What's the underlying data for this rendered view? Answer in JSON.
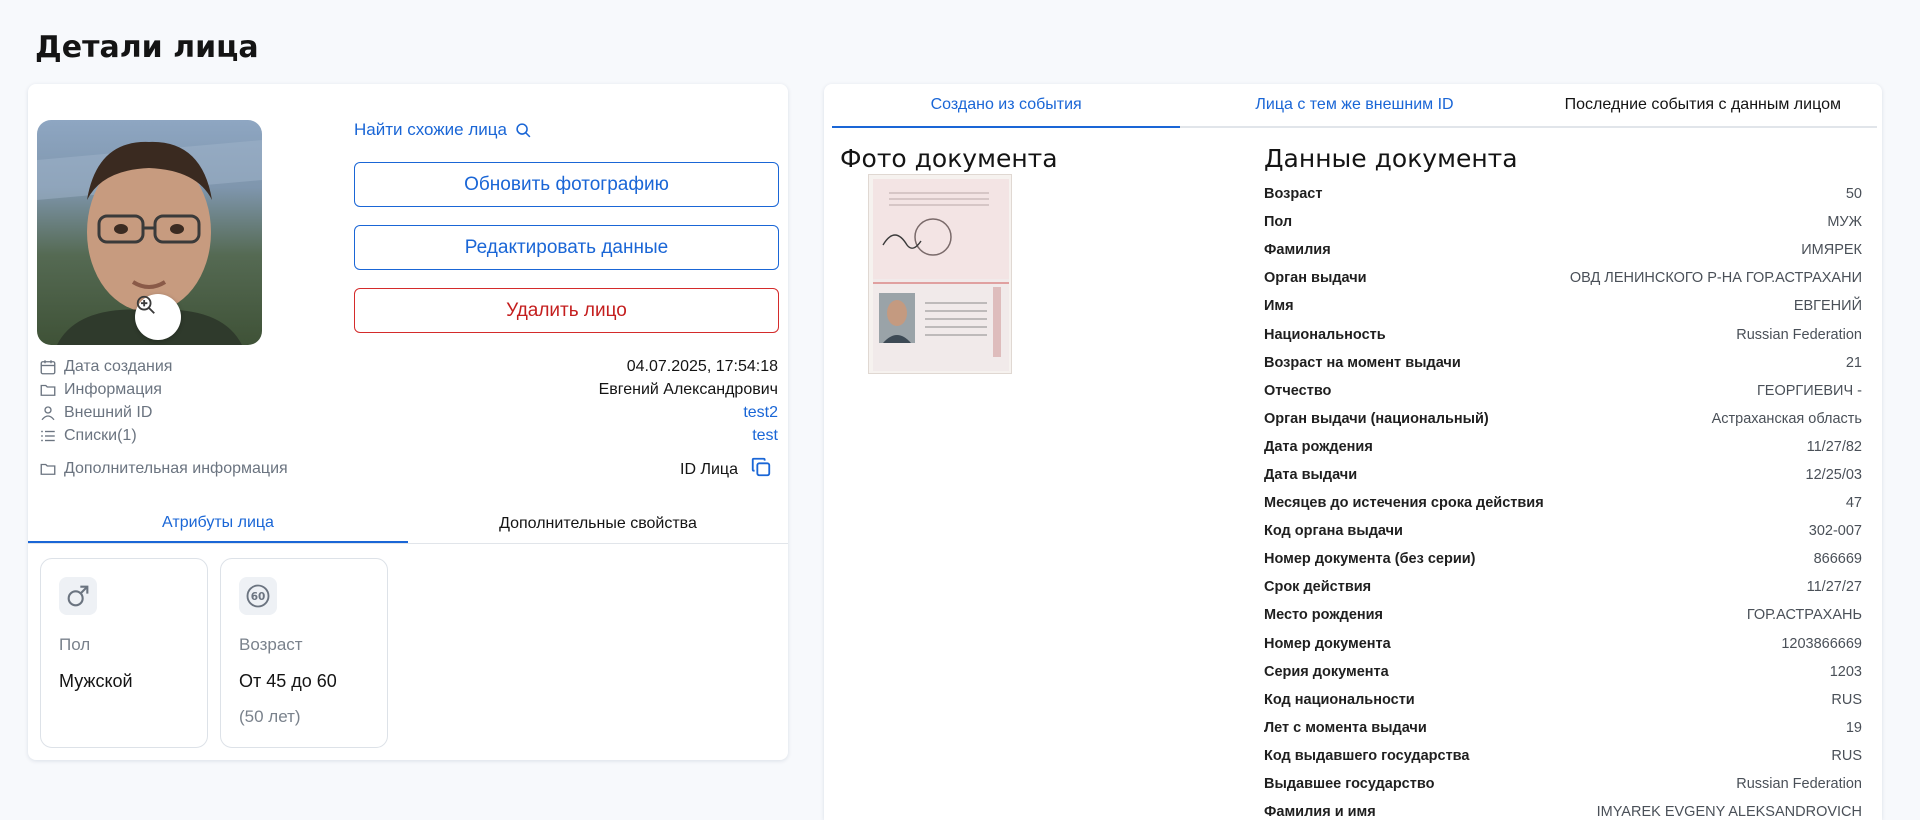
{
  "page": {
    "title": "Детали лица"
  },
  "face": {
    "find_similar": "Найти схожие лица",
    "buttons": {
      "update_photo": "Обновить фотографию",
      "edit_data": "Редактировать данные",
      "delete_face": "Удалить лицо"
    },
    "info": [
      {
        "label": "Дата создания",
        "value": "04.07.2025, 17:54:18",
        "icon": "calendar-icon",
        "link": false
      },
      {
        "label": "Информация",
        "value": "Евгений Александрович",
        "icon": "folder-icon",
        "link": false
      },
      {
        "label": "Внешний ID",
        "value": "test2",
        "icon": "user-icon",
        "link": true
      },
      {
        "label": "Списки(1)",
        "value": "test",
        "icon": "list-icon",
        "link": true
      }
    ],
    "additional_info_label": "Дополнительная информация",
    "id_face_label": "ID Лица",
    "tabs": [
      "Атрибуты лица",
      "Дополнительные свойства"
    ],
    "attributes": [
      {
        "label": "Пол",
        "value": "Мужской",
        "sub": "",
        "icon": "male-icon"
      },
      {
        "label": "Возраст",
        "value": "От 45 до 60",
        "sub": "(50 лет)",
        "icon": "age-60-icon"
      }
    ]
  },
  "colors": {
    "accent": "#1a66d6",
    "danger": "#c41e1e",
    "muted": "#6b7480"
  },
  "right": {
    "tabs": [
      "Создано из события",
      "Лица с тем же внешним ID",
      "Последние события с данным лицом"
    ],
    "doc_photo_title": "Фото документа",
    "doc_data_title": "Данные документа",
    "doc_fields": [
      {
        "key": "Возраст",
        "value": "50"
      },
      {
        "key": "Пол",
        "value": "МУЖ"
      },
      {
        "key": "Фамилия",
        "value": "ИМЯРЕК"
      },
      {
        "key": "Орган выдачи",
        "value": "ОВД ЛЕНИНСКОГО Р-НА ГОР.АСТРАХАНИ"
      },
      {
        "key": "Имя",
        "value": "ЕВГЕНИЙ"
      },
      {
        "key": "Национальность",
        "value": "Russian Federation"
      },
      {
        "key": "Возраст на момент выдачи",
        "value": "21"
      },
      {
        "key": "Отчество",
        "value": "ГЕОРГИЕВИЧ -"
      },
      {
        "key": "Орган выдачи (национальный)",
        "value": "Астраханская область"
      },
      {
        "key": "Дата рождения",
        "value": "11/27/82"
      },
      {
        "key": "Дата выдачи",
        "value": "12/25/03"
      },
      {
        "key": "Месяцев до истечения срока действия",
        "value": "47"
      },
      {
        "key": "Код органа выдачи",
        "value": "302-007"
      },
      {
        "key": "Номер документа (без серии)",
        "value": "866669"
      },
      {
        "key": "Срок действия",
        "value": "11/27/27"
      },
      {
        "key": "Место рождения",
        "value": "ГОР.АСТРАХАНЬ"
      },
      {
        "key": "Номер документа",
        "value": "1203866669"
      },
      {
        "key": "Серия документа",
        "value": "1203"
      },
      {
        "key": "Код национальности",
        "value": "RUS"
      },
      {
        "key": "Лет с момента выдачи",
        "value": "19"
      },
      {
        "key": "Код выдавшего государства",
        "value": "RUS"
      },
      {
        "key": "Выдавшее государство",
        "value": "Russian Federation"
      },
      {
        "key": "Фамилия и имя",
        "value": "IMYAREK EVGENY ALEKSANDROVICH"
      }
    ]
  }
}
